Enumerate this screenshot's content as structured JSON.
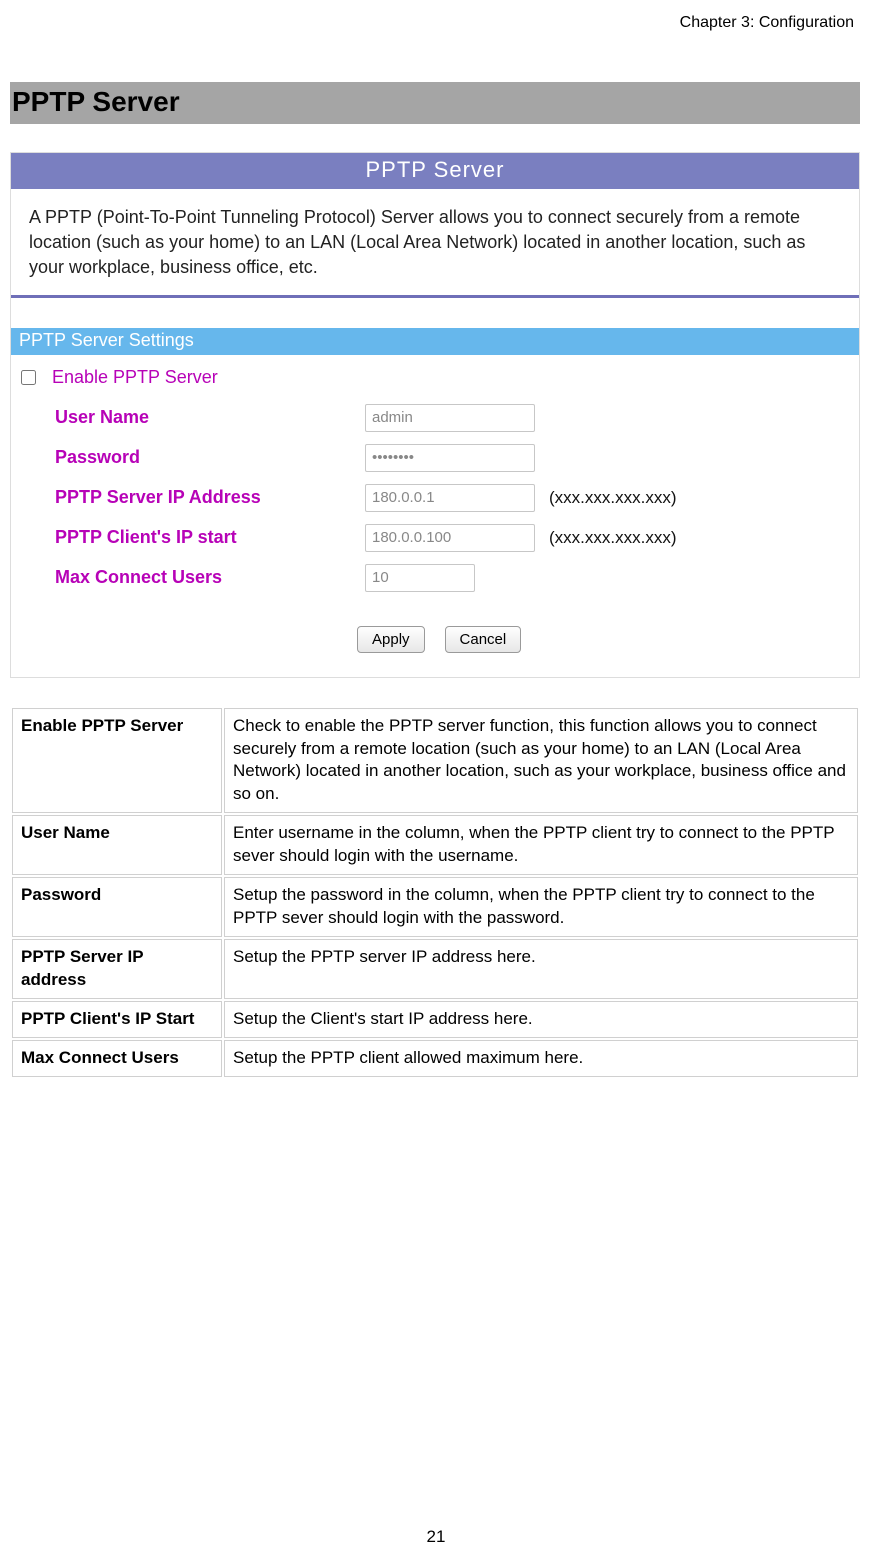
{
  "chapter": "Chapter 3: Configuration",
  "sectionTitle": "PPTP Server",
  "panel": {
    "title": "PPTP Server",
    "description": "A PPTP (Point-To-Point Tunneling Protocol) Server allows you to connect securely from a remote location (such as your home) to an LAN (Local Area Network) located in another location, such as your workplace, business office, etc.",
    "settingsHeader": "PPTP Server Settings",
    "enableLabel": "Enable PPTP Server",
    "fields": {
      "userName": {
        "label": "User Name",
        "value": "admin"
      },
      "password": {
        "label": "Password",
        "value": "••••••••"
      },
      "serverIp": {
        "label": "PPTP Server IP Address",
        "value": "180.0.0.1",
        "hint": "(xxx.xxx.xxx.xxx)"
      },
      "clientIpStart": {
        "label": "PPTP Client's IP start",
        "value": "180.0.0.100",
        "hint": "(xxx.xxx.xxx.xxx)"
      },
      "maxUsers": {
        "label": "Max Connect Users",
        "value": "10"
      }
    },
    "buttons": {
      "apply": "Apply",
      "cancel": "Cancel"
    }
  },
  "descTable": [
    {
      "term": "Enable PPTP Server",
      "desc": "Check to enable the PPTP server function, this function allows you to connect securely from a remote location (such as your home) to an LAN (Local Area Network) located in another location, such as your workplace, business office and so on."
    },
    {
      "term": "User Name",
      "desc": "Enter username in the column, when the PPTP client try to connect to the PPTP sever should login with the username."
    },
    {
      "term": "Password",
      "desc": "Setup the password in the column, when the PPTP client try to connect to the PPTP sever should login with the password."
    },
    {
      "term": "PPTP Server IP address",
      "desc": "Setup the PPTP server IP address here."
    },
    {
      "term": "PPTP Client's IP Start",
      "desc": "Setup the Client's start IP address here."
    },
    {
      "term": "Max Connect Users",
      "desc": "Setup the PPTP client allowed maximum here."
    }
  ],
  "pageNumber": "21"
}
